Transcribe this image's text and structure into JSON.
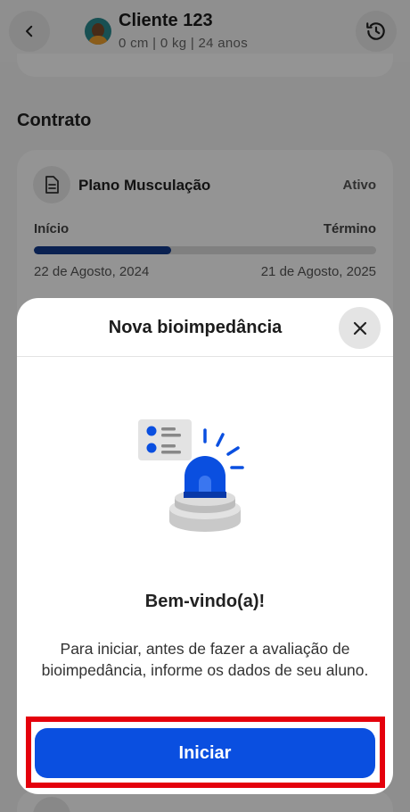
{
  "header": {
    "client_name": "Cliente 123",
    "client_meta": "0 cm |  0 kg |  24 anos",
    "back_icon": "chevron-left-icon",
    "history_icon": "history-icon"
  },
  "contract": {
    "section_title": "Contrato",
    "plan_name": "Plano Musculação",
    "status": "Ativo",
    "start_label": "Início",
    "end_label": "Término",
    "start_date": "22 de Agosto, 2024",
    "end_date": "21 de Agosto, 2025",
    "progress_fraction": 0.4,
    "progress_color": "#123a8c"
  },
  "modal": {
    "title": "Nova bioimpedância",
    "close_icon": "close-icon",
    "illustration": "siren-alert-icon",
    "welcome": "Bem-vindo(a)!",
    "description": "Para iniciar, antes de fazer a avaliação de bioimpedância, informe os dados de seu aluno.",
    "start_label": "Iniciar",
    "accent_color": "#0a4fe0"
  },
  "highlight_color": "#e4000c"
}
